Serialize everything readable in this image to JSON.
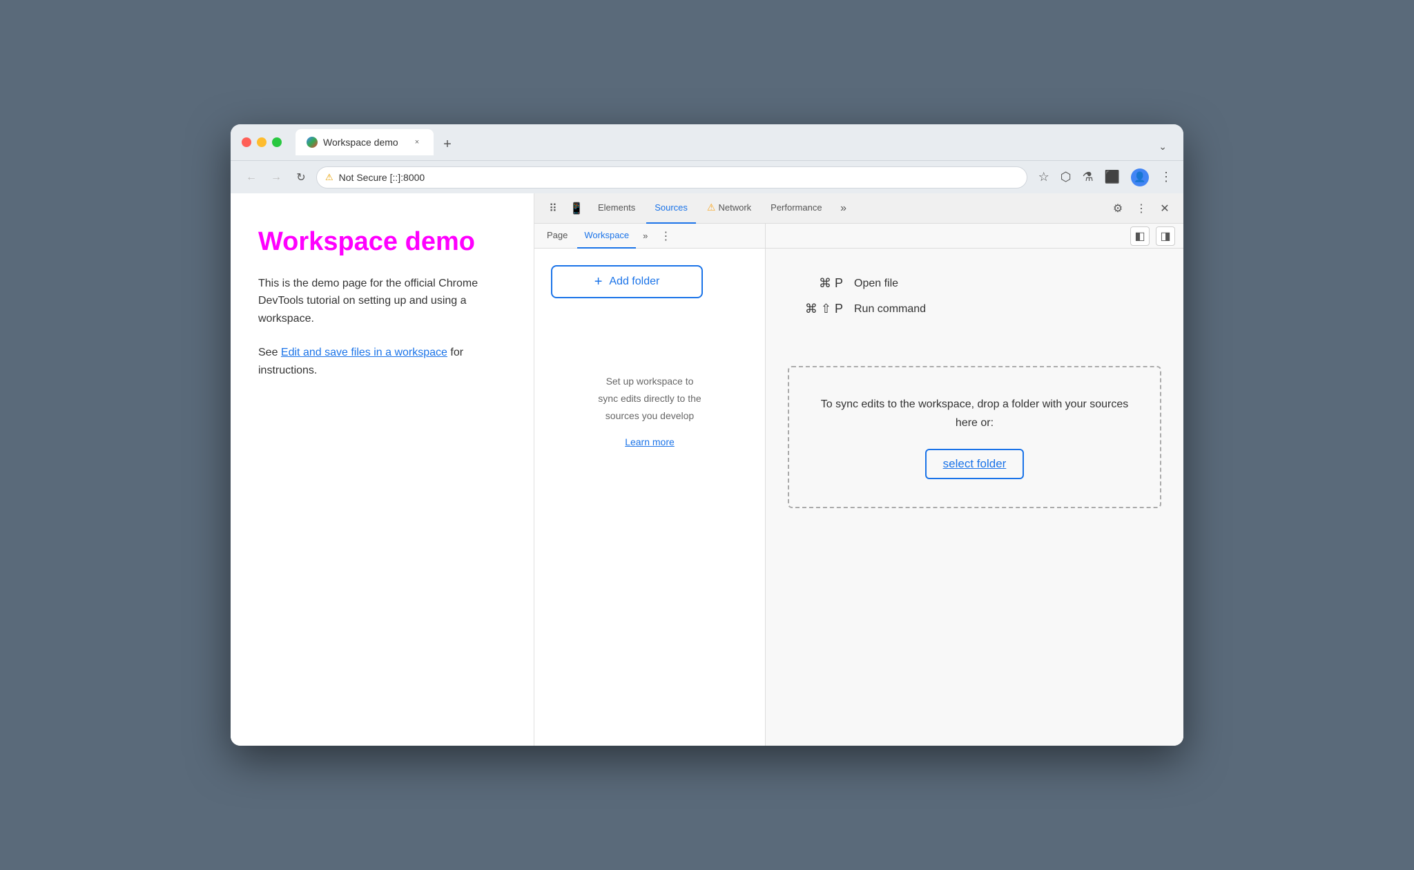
{
  "browser": {
    "tab": {
      "title": "Workspace demo",
      "close_label": "×",
      "new_tab_label": "+"
    },
    "nav": {
      "back_icon": "←",
      "forward_icon": "→",
      "refresh_icon": "↻",
      "security_icon": "⚠",
      "url": "Not Secure   [::]:8000",
      "bookmark_icon": "☆",
      "extension_icon": "⬡",
      "lab_icon": "⚗",
      "layout_icon": "⬛",
      "menu_icon": "⋮",
      "chevron_icon": "⌄"
    }
  },
  "page": {
    "title": "Workspace demo",
    "description": "This is the demo page for the official Chrome DevTools tutorial on setting up and using a workspace.",
    "link_prefix": "See ",
    "link_text": "Edit and save files in a workspace",
    "link_suffix": " for instructions."
  },
  "devtools": {
    "tabs": [
      {
        "label": "Elements",
        "active": false
      },
      {
        "label": "Sources",
        "active": true
      },
      {
        "label": "Network",
        "active": false,
        "warning": true
      },
      {
        "label": "Performance",
        "active": false
      }
    ],
    "more_tabs_icon": "»",
    "settings_icon": "⚙",
    "menu_icon": "⋮",
    "close_icon": "✕",
    "inspector_icon": "⬚",
    "device_icon": "⬜"
  },
  "sources": {
    "tabs": [
      {
        "label": "Page",
        "active": false
      },
      {
        "label": "Workspace",
        "active": true
      }
    ],
    "more_tabs_label": "»",
    "menu_icon": "⋮",
    "add_folder_label": "+ Add folder",
    "add_folder_plus": "+",
    "workspace_info_text": "Set up workspace to\nsync edits directly to the\nsources you develop",
    "learn_more_label": "Learn more",
    "sidebar_toggle_icon": "◧",
    "sidebar_toggle_right_icon": "◨",
    "shortcuts": [
      {
        "keys": "⌘ P",
        "description": "Open file"
      },
      {
        "keys": "⌘ ⇧ P",
        "description": "Run command"
      }
    ],
    "drop_zone_text": "To sync edits to the workspace, drop a folder with your sources here or:",
    "select_folder_label": "select folder"
  }
}
